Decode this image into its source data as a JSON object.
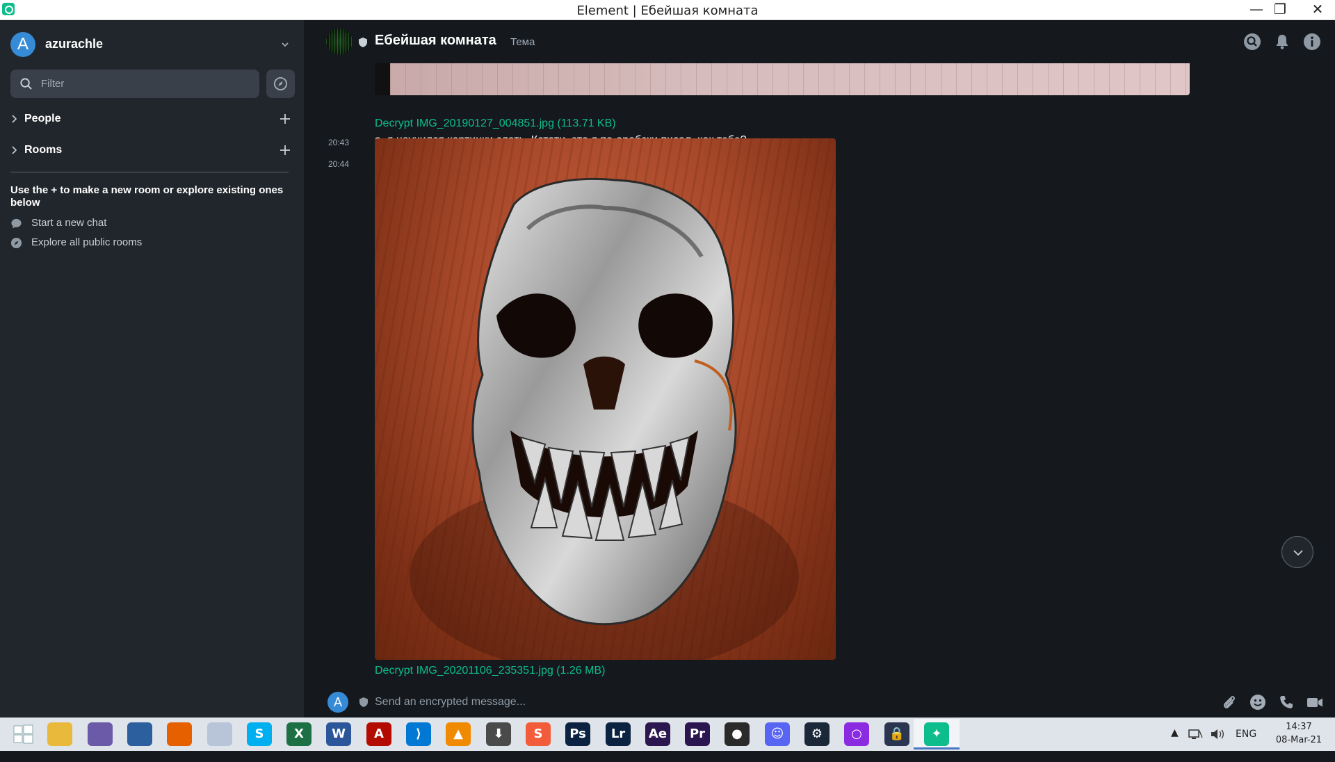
{
  "window": {
    "title": "Element | Ебейшая комната",
    "minimize": "—",
    "restore": "❐",
    "close": "✕"
  },
  "sidebar": {
    "user": {
      "initial": "A",
      "name": "azurachle"
    },
    "filter": {
      "placeholder": "Filter",
      "value": ""
    },
    "sections": [
      {
        "label": "People"
      },
      {
        "label": "Rooms"
      }
    ],
    "hint": "Use the + to make a new room or explore existing ones below",
    "hint_items": [
      {
        "label": "Start a new chat",
        "icon": "chat-bubble-icon"
      },
      {
        "label": "Explore all public rooms",
        "icon": "compass-icon"
      }
    ]
  },
  "room": {
    "name": "Ебейшая комната",
    "topic": "Тема",
    "header_icons": [
      "search-icon",
      "bell-icon",
      "info-icon"
    ]
  },
  "timeline": {
    "file1": "Decrypt IMG_20190127_004851.jpg (113.71 KB)",
    "messages": [
      {
        "time": "20:43",
        "text": "о, я научился картинки слать. Кстати, это я по-арабски писал, как тебе?"
      },
      {
        "time": "20:44",
        "text": ""
      }
    ],
    "file2": "Decrypt IMG_20201106_235351.jpg (1.26 MB)"
  },
  "composer": {
    "initial": "A",
    "placeholder": "Send an encrypted message...",
    "value": ""
  },
  "taskbar": {
    "apps": [
      {
        "name": "start",
        "glyph": "",
        "color": "#dfe3ea"
      },
      {
        "name": "file-explorer",
        "glyph": "",
        "color": "#e8b93a"
      },
      {
        "name": "torrent",
        "glyph": "",
        "color": "#6b5aa8"
      },
      {
        "name": "browser-globe",
        "glyph": "",
        "color": "#2c5f9e"
      },
      {
        "name": "firefox",
        "glyph": "",
        "color": "#e66000"
      },
      {
        "name": "moon-app",
        "glyph": "",
        "color": "#b8c4d8"
      },
      {
        "name": "skype",
        "glyph": "S",
        "color": "#00aff0"
      },
      {
        "name": "excel",
        "glyph": "X",
        "color": "#1d7044"
      },
      {
        "name": "word",
        "glyph": "W",
        "color": "#2b579a"
      },
      {
        "name": "acrobat",
        "glyph": "A",
        "color": "#b30b00"
      },
      {
        "name": "vscode",
        "glyph": "⟩",
        "color": "#0078d4"
      },
      {
        "name": "vlc",
        "glyph": "▲",
        "color": "#f08a00"
      },
      {
        "name": "downloader",
        "glyph": "⬇",
        "color": "#4a4a4a"
      },
      {
        "name": "sublime",
        "glyph": "S",
        "color": "#f25c3a"
      },
      {
        "name": "photoshop",
        "glyph": "Ps",
        "color": "#0b2240"
      },
      {
        "name": "lightroom",
        "glyph": "Lr",
        "color": "#0b2240"
      },
      {
        "name": "after-effects",
        "glyph": "Ae",
        "color": "#2b1650"
      },
      {
        "name": "premiere",
        "glyph": "Pr",
        "color": "#2b1650"
      },
      {
        "name": "obs",
        "glyph": "●",
        "color": "#2a2a2a"
      },
      {
        "name": "discord",
        "glyph": "☺",
        "color": "#5865f2"
      },
      {
        "name": "steam",
        "glyph": "⚙",
        "color": "#1b2838"
      },
      {
        "name": "cortana",
        "glyph": "○",
        "color": "#8a2be2"
      },
      {
        "name": "keepass",
        "glyph": "🔒",
        "color": "#2a3550"
      },
      {
        "name": "element",
        "glyph": "✦",
        "color": "#0dbd8b"
      }
    ],
    "tray": {
      "arrow": "▲",
      "lang": "ENG"
    },
    "clock": {
      "time": "14:37",
      "date": "08-Mar-21"
    }
  }
}
